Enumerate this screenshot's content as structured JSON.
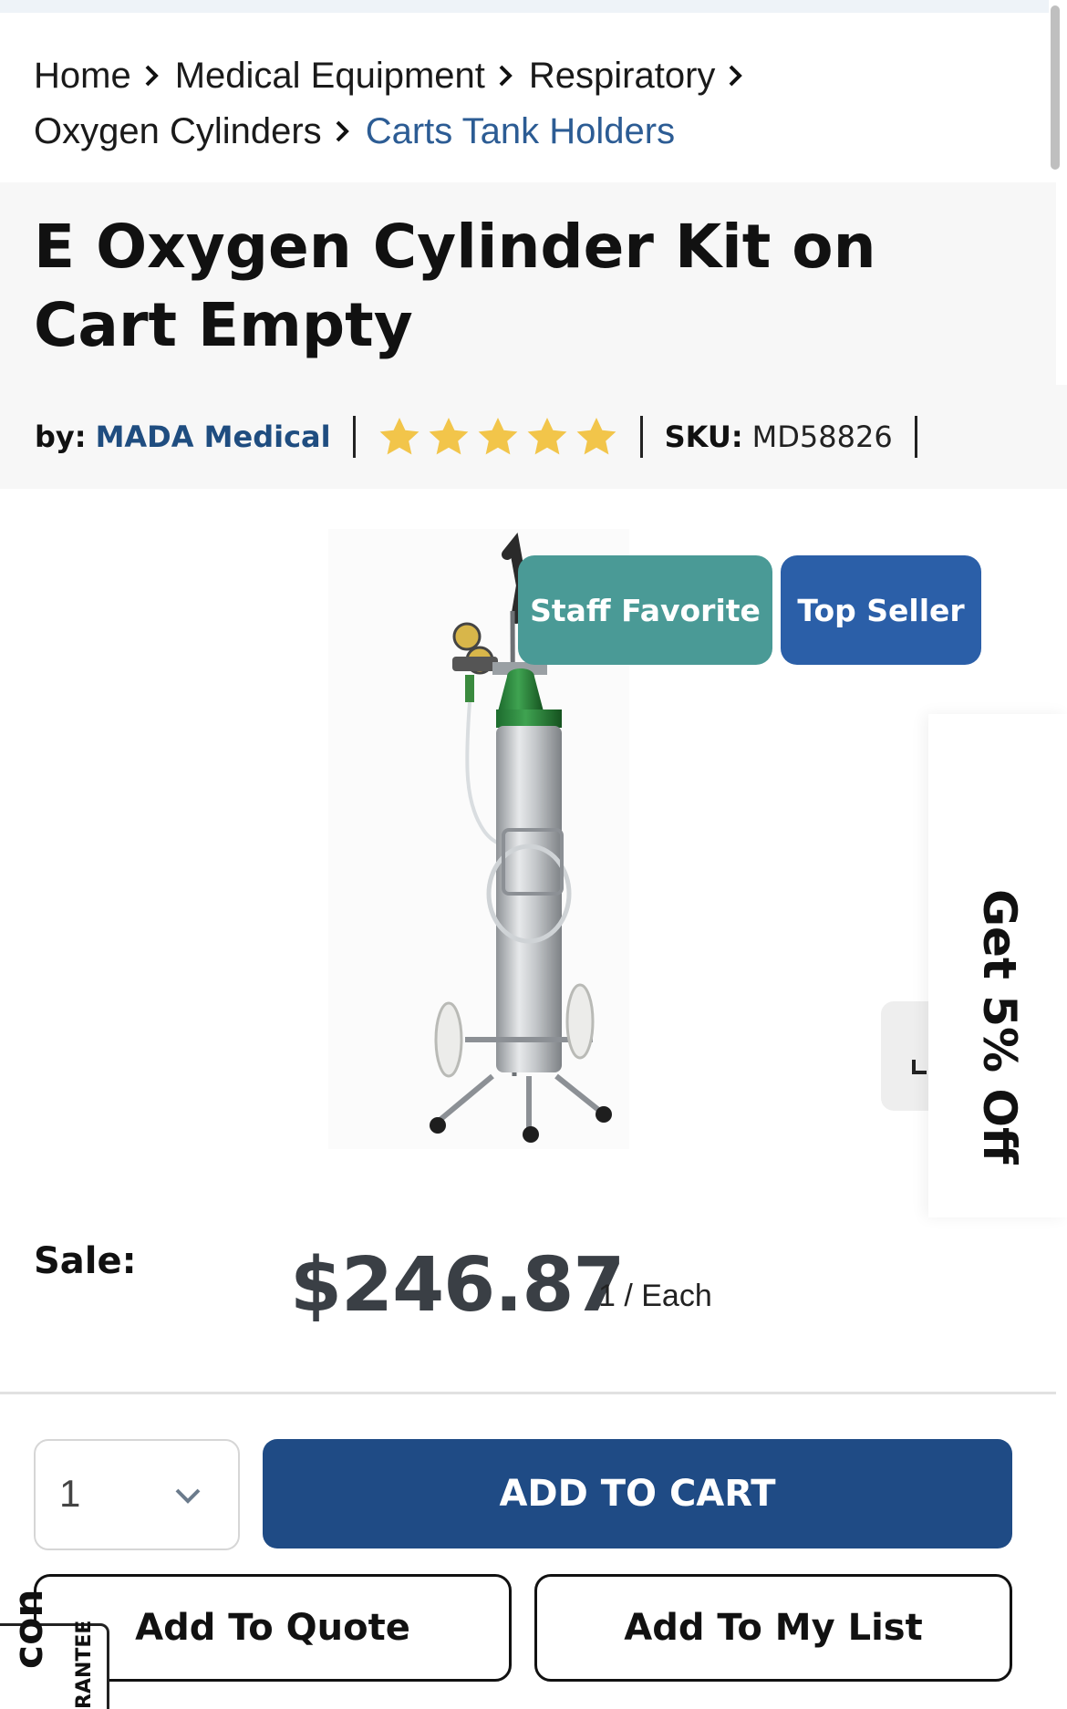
{
  "breadcrumb": {
    "items": [
      "Home",
      "Medical Equipment",
      "Respiratory",
      "Oxygen Cylinders"
    ],
    "current": "Carts Tank Holders"
  },
  "product": {
    "title": "E Oxygen Cylinder Kit on Cart Empty",
    "by_label": "by:",
    "brand": "MADA Medical",
    "rating_stars": 5,
    "rating_color": "#f2c54a",
    "sku_label": "SKU:",
    "sku": "MD58826",
    "image_icon": "oxygen-cylinder-cart-image"
  },
  "badges": {
    "staff_favorite": "Staff Favorite",
    "top_seller": "Top Seller",
    "staff_color": "#4a9a96",
    "top_color": "#2b5fa8"
  },
  "promo": {
    "label": "Get 5% Off"
  },
  "pricing": {
    "sale_label": "Sale:",
    "price": "$246.87",
    "unit": "1 / Each"
  },
  "purchase": {
    "quantity": "1",
    "add_to_cart": "ADD TO CART",
    "add_to_quote": "Add To Quote",
    "add_to_list": "Add To My List",
    "accent": "#1f4b85"
  },
  "guarantee": {
    "mark": "con",
    "word": "RANTEE"
  }
}
